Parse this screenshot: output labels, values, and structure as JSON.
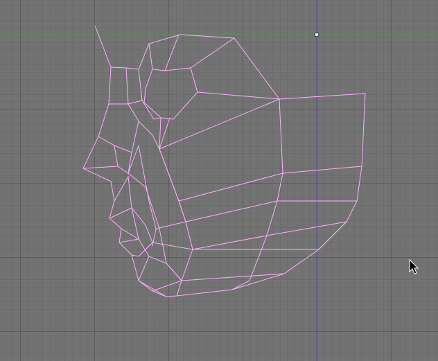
{
  "viewport": {
    "background": "#737373",
    "grid_minor_color": "#6c6c6c",
    "grid_major_color": "#5c5c5c",
    "x_axis_color": "#5c9a5c",
    "z_axis_color": "#5050a8",
    "wire_color": "#ffb0ff",
    "origin_marker": "pivot-dot",
    "cursor_icon": "arrow-cursor-icon"
  }
}
